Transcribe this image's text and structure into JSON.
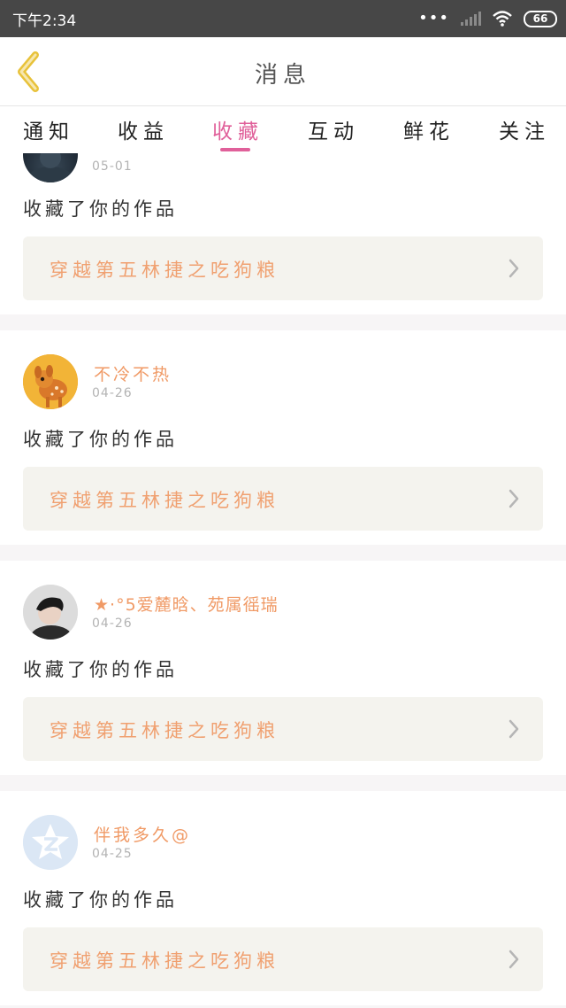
{
  "status_bar": {
    "time": "下午2:34",
    "dots": "•••",
    "battery": "66"
  },
  "header": {
    "title": "消息",
    "back_icon": "chevron-left-icon",
    "accent_color": "#e8c23a"
  },
  "tabs": [
    {
      "label": "通知",
      "active": false
    },
    {
      "label": "收益",
      "active": false
    },
    {
      "label": "收藏",
      "active": true
    },
    {
      "label": "互动",
      "active": false
    },
    {
      "label": "鲜花",
      "active": false
    },
    {
      "label": "关注",
      "active": false
    }
  ],
  "tab_active_color": "#e0609a",
  "messages": [
    {
      "user": "",
      "date": "05-01",
      "action": "收藏了你的作品",
      "work": "穿越第五林捷之吃狗粮"
    },
    {
      "user": "不冷不热",
      "date": "04-26",
      "action": "收藏了你的作品",
      "work": "穿越第五林捷之吃狗粮"
    },
    {
      "user": "★·°5爱麓晗、苑属徭瑞",
      "date": "04-26",
      "action": "收藏了你的作品",
      "work": "穿越第五林捷之吃狗粮"
    },
    {
      "user": "伴我多久@",
      "date": "04-25",
      "action": "收藏了你的作品",
      "work": "穿越第五林捷之吃狗粮"
    }
  ]
}
